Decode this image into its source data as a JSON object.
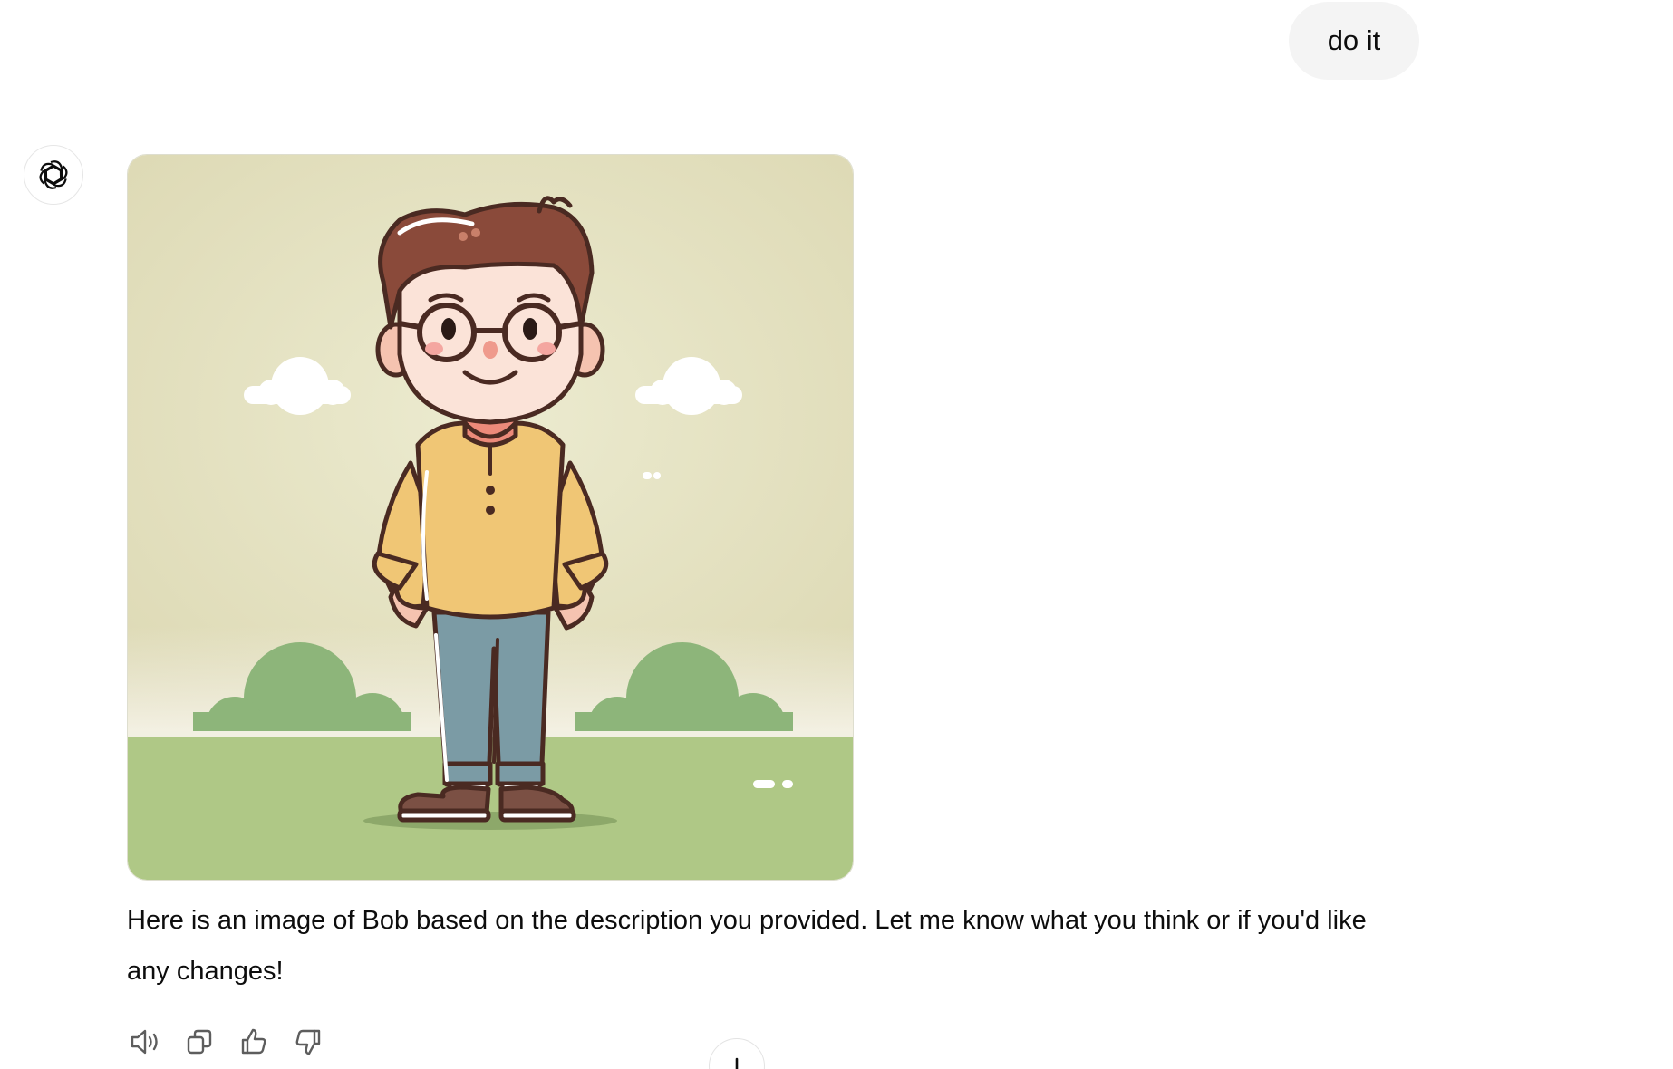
{
  "conversation": {
    "user_message": "do it",
    "assistant_reply": "Here is an image of Bob based on the description you provided. Let me know what you think or if you'd like any changes!"
  },
  "icons": {
    "assistant_avatar": "openai-logo-icon",
    "read_aloud": "speaker-icon",
    "copy": "copy-icon",
    "good_response": "thumbs-up-icon",
    "bad_response": "thumbs-down-icon",
    "scroll_down": "arrow-down-icon"
  },
  "colors": {
    "user_bubble": "#f4f4f4",
    "image_sky": "#e3dfba",
    "image_ground": "#aec786",
    "icon_gray": "#5d5d5d"
  }
}
